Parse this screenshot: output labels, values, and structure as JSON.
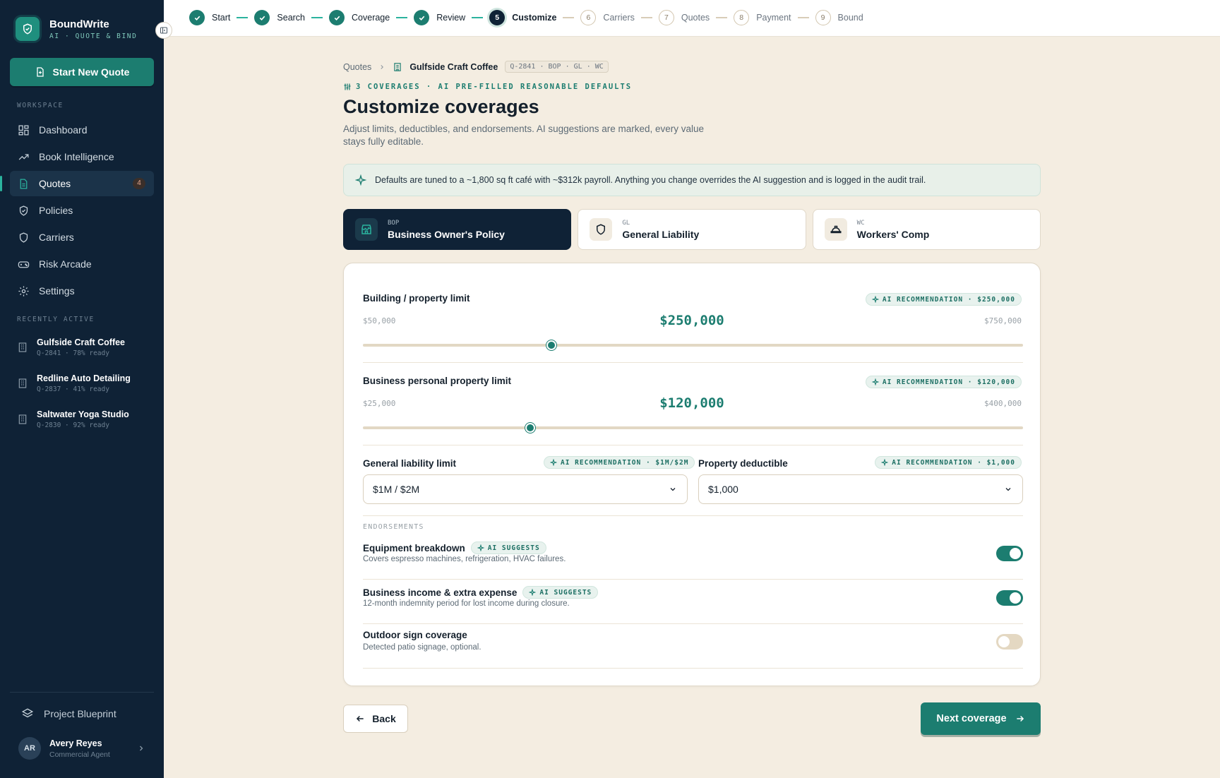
{
  "brand": {
    "name": "BoundWrite",
    "tagline": "AI · QUOTE & BIND"
  },
  "sidebar": {
    "new_quote_label": "Start New Quote",
    "workspace_title": "WORKSPACE",
    "nav": [
      {
        "label": "Dashboard",
        "icon": "grid-icon"
      },
      {
        "label": "Book Intelligence",
        "icon": "trend-icon"
      },
      {
        "label": "Quotes",
        "icon": "document-icon",
        "badge": "4",
        "active": true
      },
      {
        "label": "Policies",
        "icon": "shield-check-icon"
      },
      {
        "label": "Carriers",
        "icon": "shield-icon"
      },
      {
        "label": "Risk Arcade",
        "icon": "gamepad-icon"
      },
      {
        "label": "Settings",
        "icon": "gear-icon"
      }
    ],
    "recent_title": "RECENTLY ACTIVE",
    "recent": [
      {
        "name": "Gulfside Craft Coffee",
        "meta": "Q-2841 · 78% ready"
      },
      {
        "name": "Redline Auto Detailing",
        "meta": "Q-2837 · 41% ready"
      },
      {
        "name": "Saltwater Yoga Studio",
        "meta": "Q-2830 · 92% ready"
      }
    ],
    "blueprint_label": "Project Blueprint",
    "user": {
      "initials": "AR",
      "name": "Avery Reyes",
      "role": "Commercial Agent"
    }
  },
  "stepper": [
    {
      "num": "1",
      "label": "Start",
      "state": "done"
    },
    {
      "num": "2",
      "label": "Search",
      "state": "done"
    },
    {
      "num": "3",
      "label": "Coverage",
      "state": "done"
    },
    {
      "num": "4",
      "label": "Review",
      "state": "done"
    },
    {
      "num": "5",
      "label": "Customize",
      "state": "current"
    },
    {
      "num": "6",
      "label": "Carriers",
      "state": "todo"
    },
    {
      "num": "7",
      "label": "Quotes",
      "state": "todo"
    },
    {
      "num": "8",
      "label": "Payment",
      "state": "todo"
    },
    {
      "num": "9",
      "label": "Bound",
      "state": "todo"
    }
  ],
  "breadcrumb": {
    "root": "Quotes",
    "current": "Gulfside Craft Coffee",
    "tag": "Q-2841 · BOP · GL · WC"
  },
  "page": {
    "kicker": "3 COVERAGES · AI PRE-FILLED REASONABLE DEFAULTS",
    "title": "Customize coverages",
    "subtitle": "Adjust limits, deductibles, and endorsements. AI suggestions are marked, every value stays fully editable.",
    "banner": "Defaults are tuned to a ~1,800 sq ft café with ~$312k payroll. Anything you change overrides the AI suggestion and is logged in the audit trail."
  },
  "tabs": [
    {
      "code": "BOP",
      "name": "Business Owner's Policy",
      "icon": "storefront-icon",
      "active": true
    },
    {
      "code": "GL",
      "name": "General Liability",
      "icon": "shield-icon"
    },
    {
      "code": "WC",
      "name": "Workers' Comp",
      "icon": "hardhat-icon"
    }
  ],
  "sliders": [
    {
      "label": "Building / property limit",
      "ai": "AI RECOMMENDATION · $250,000",
      "min_label": "$50,000",
      "max_label": "$750,000",
      "value_label": "$250,000",
      "min": 50000,
      "max": 750000,
      "value": 250000
    },
    {
      "label": "Business personal property limit",
      "ai": "AI RECOMMENDATION · $120,000",
      "min_label": "$25,000",
      "max_label": "$400,000",
      "value_label": "$120,000",
      "min": 25000,
      "max": 400000,
      "value": 120000
    }
  ],
  "selects": [
    {
      "label": "General liability limit",
      "ai": "AI RECOMMENDATION · $1M/$2M",
      "value": "$1M / $2M"
    },
    {
      "label": "Property deductible",
      "ai": "AI RECOMMENDATION · $1,000",
      "value": "$1,000"
    }
  ],
  "endorsements_title": "ENDORSEMENTS",
  "endorsements": [
    {
      "title": "Equipment breakdown",
      "ai": "AI SUGGESTS",
      "desc": "Covers espresso machines, refrigeration, HVAC failures.",
      "on": true
    },
    {
      "title": "Business income & extra expense",
      "ai": "AI SUGGESTS",
      "desc": "12-month indemnity period for lost income during closure.",
      "on": true
    },
    {
      "title": "Outdoor sign coverage",
      "ai": "",
      "desc": "Detected patio signage, optional.",
      "on": false
    }
  ],
  "footer": {
    "back_label": "Back",
    "next_label": "Next coverage"
  },
  "colors": {
    "accent": "#1c7d70",
    "sidebar": "#0f2236",
    "background": "#f4ede1"
  }
}
